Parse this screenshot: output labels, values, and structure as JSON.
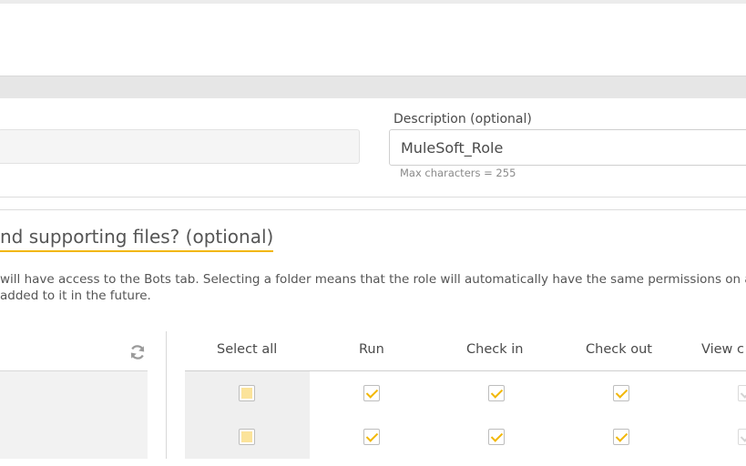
{
  "form": {
    "description_label": "Description (optional)",
    "description_value": "MuleSoft_Role",
    "description_hint": "Max characters = 255"
  },
  "section": {
    "heading": "nd supporting files? (optional)",
    "desc_line1": "will have access to the Bots tab. Selecting a folder means that the role will automatically have the same permissions on a",
    "desc_line2": "added to it in the future."
  },
  "permissions": {
    "columns": [
      "Select all",
      "Run",
      "Check in",
      "Check out",
      "View c"
    ],
    "rows": [
      {
        "select_all": "partial",
        "run": true,
        "check_in": true,
        "check_out": true,
        "view": true
      },
      {
        "select_all": "partial",
        "run": true,
        "check_in": true,
        "check_out": true,
        "view": true
      }
    ]
  },
  "colors": {
    "accent": "#f2b705",
    "partial_fill": "#fbe39a",
    "band": "#e6e6e6"
  },
  "icons": {
    "refresh": "refresh-icon"
  }
}
